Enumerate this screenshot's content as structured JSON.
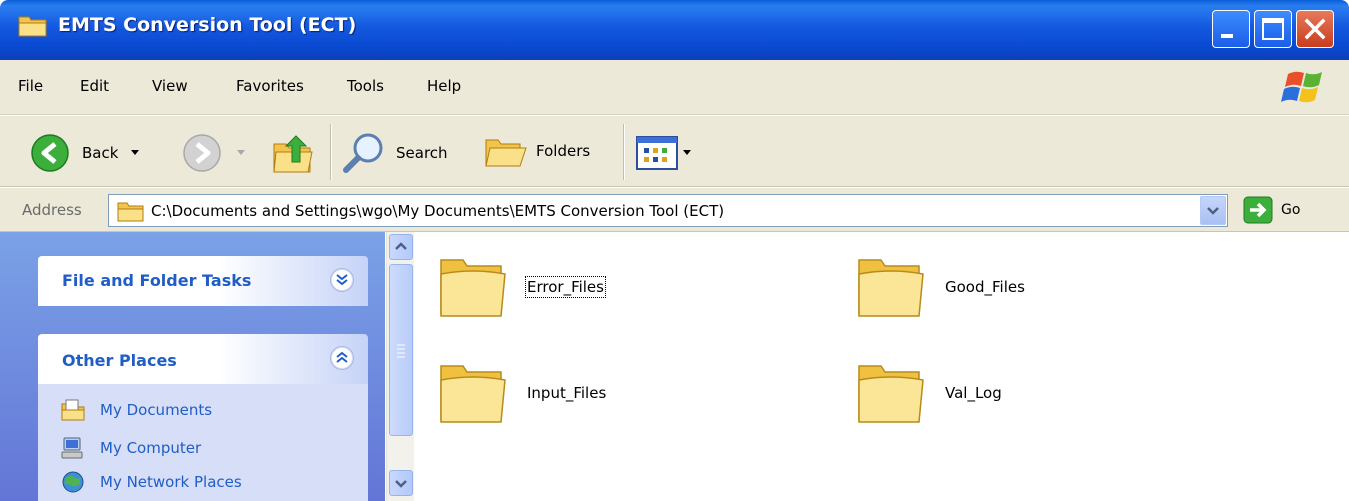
{
  "window": {
    "title": "EMTS Conversion Tool (ECT)"
  },
  "menu": {
    "items": [
      "File",
      "Edit",
      "View",
      "Favorites",
      "Tools",
      "Help"
    ]
  },
  "toolbar": {
    "back_label": "Back",
    "search_label": "Search",
    "folders_label": "Folders"
  },
  "address": {
    "label": "Address",
    "path": "C:\\Documents and Settings\\wgo\\My Documents\\EMTS Conversion Tool (ECT)",
    "go_label": "Go"
  },
  "taskpane": {
    "file_tasks_title": "File and Folder Tasks",
    "other_places_title": "Other Places",
    "places": [
      "My Documents",
      "My Computer",
      "My Network Places"
    ]
  },
  "folders": [
    {
      "name": "Error_Files",
      "focused": true
    },
    {
      "name": "Good_Files",
      "focused": false
    },
    {
      "name": "Input_Files",
      "focused": false
    },
    {
      "name": "Val_Log",
      "focused": false
    }
  ],
  "colors": {
    "titlebar": "#0a48d0",
    "taskpane_link": "#215dc6",
    "chrome": "#ece9d8"
  }
}
